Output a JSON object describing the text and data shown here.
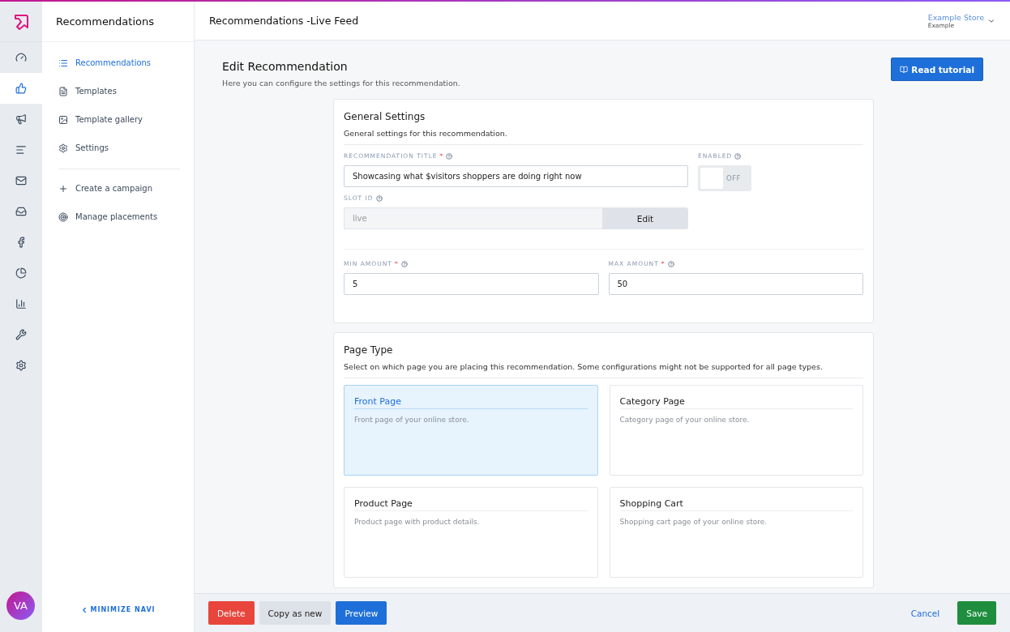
{
  "rail": {
    "items": [
      {
        "selected": false
      },
      {
        "selected": true
      },
      {
        "selected": false
      },
      {
        "selected": false
      },
      {
        "selected": false
      },
      {
        "selected": false
      },
      {
        "selected": false
      },
      {
        "selected": false
      },
      {
        "selected": false
      },
      {
        "selected": false
      },
      {
        "selected": false
      }
    ],
    "avatar": "VA"
  },
  "subnav": {
    "title": "Recommendations",
    "items": [
      {
        "label": "Recommendations",
        "selected": true
      },
      {
        "label": "Templates",
        "selected": false
      },
      {
        "label": "Template gallery",
        "selected": false
      },
      {
        "label": "Settings",
        "selected": false
      }
    ],
    "actions": [
      {
        "label": "Create a campaign"
      },
      {
        "label": "Manage placements"
      }
    ],
    "minimize": "MINIMIZE NAVI"
  },
  "header": {
    "title": "Recommendations -Live Feed",
    "store": "Example Store",
    "store_sub": "Example"
  },
  "page": {
    "title": "Edit Recommendation",
    "subtitle": "Here you can configure the settings for this recommendation.",
    "tutorial_button": "Read tutorial"
  },
  "general": {
    "title": "General Settings",
    "subtitle": "General settings for this recommendation.",
    "title_field": {
      "label": "RECOMMENDATION TITLE",
      "marker": "*",
      "value": "Showcasing what $visitors shoppers are doing right now"
    },
    "enabled": {
      "label": "ENABLED",
      "on": false,
      "state_text": "OFF"
    },
    "slot": {
      "label": "SLOT ID",
      "value": "live",
      "disabled": true,
      "button": "Edit"
    },
    "min": {
      "label": "MIN AMOUNT",
      "marker": "*",
      "value": "5"
    },
    "max": {
      "label": "MAX AMOUNT",
      "marker": "*",
      "value": "50"
    }
  },
  "page_type": {
    "title": "Page Type",
    "subtitle": "Select on which page you are placing this recommendation. Some configurations might not be supported for all page types.",
    "options": [
      {
        "title": "Front Page",
        "description": "Front page of your online store.",
        "selected": true
      },
      {
        "title": "Category Page",
        "description": "Category page of your online store.",
        "selected": false
      },
      {
        "title": "Product Page",
        "description": "Product page with product details.",
        "selected": false
      },
      {
        "title": "Shopping Cart",
        "description": "Shopping cart page of your online store.",
        "selected": false
      }
    ]
  },
  "footer": {
    "delete": "Delete",
    "copy": "Copy as new",
    "preview": "Preview",
    "cancel": "Cancel",
    "save": "Save"
  }
}
